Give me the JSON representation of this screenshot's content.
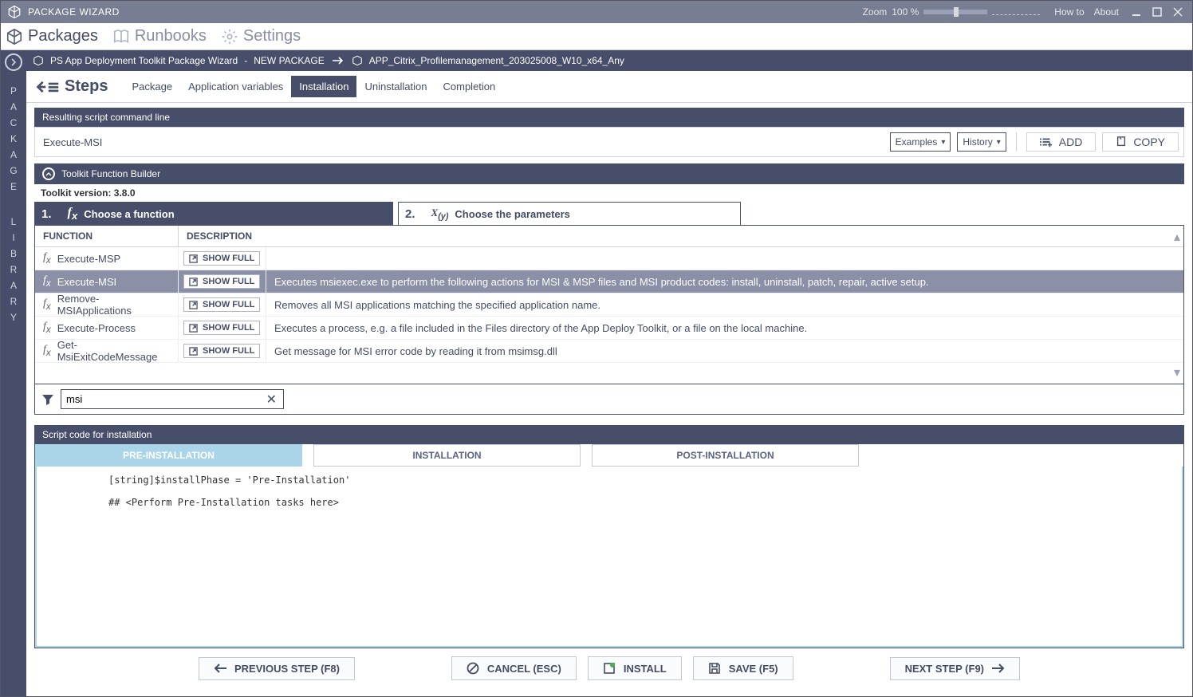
{
  "titlebar": {
    "app_title": "PACKAGE WIZARD",
    "zoom_label": "Zoom",
    "zoom_value": "100 %",
    "howto": "How to",
    "about": "About"
  },
  "topnav": {
    "packages": "Packages",
    "runbooks": "Runbooks",
    "settings": "Settings"
  },
  "sidebar": {
    "label1": "PACKAGE",
    "label2": "LIBRARY"
  },
  "breadcrumb": {
    "wizard": "PS App Deployment Toolkit Package Wizard",
    "sep": "-",
    "newpkg": "NEW PACKAGE",
    "target": "APP_Citrix_Profilemanagement_203025008_W10_x64_Any"
  },
  "stepsbar": {
    "label": "Steps",
    "items": [
      "Package",
      "Application variables",
      "Installation",
      "Uninstallation",
      "Completion"
    ],
    "active_index": 2
  },
  "cmdline": {
    "heading": "Resulting script command line",
    "value": "Execute-MSI",
    "examples": "Examples",
    "history": "History",
    "add": "ADD",
    "copy": "COPY"
  },
  "tfb": {
    "heading": "Toolkit Function Builder",
    "version_label": "Toolkit version:",
    "version": "3.8.0",
    "step1": "Choose a function",
    "step2": "Choose the parameters",
    "col_function": "FUNCTION",
    "col_description": "DESCRIPTION",
    "showfull": "SHOW FULL",
    "filter_value": "msi",
    "rows": [
      {
        "name": "Execute-MSP",
        "desc": ""
      },
      {
        "name": "Execute-MSI",
        "desc": "Executes msiexec.exe to perform the following actions for MSI & MSP files and MSI product codes: install, uninstall, patch, repair, active setup.",
        "selected": true
      },
      {
        "name": "Remove-MSIApplications",
        "desc": "Removes all MSI applications matching the specified application name."
      },
      {
        "name": "Execute-Process",
        "desc": "Executes a process, e.g. a file included in the Files directory of the App Deploy Toolkit, or a file on the local machine."
      },
      {
        "name": "Get-MsiExitCodeMessage",
        "desc": "Get message for MSI error code by reading it from msimsg.dll"
      }
    ]
  },
  "script": {
    "heading": "Script code for installation",
    "tabs": [
      "PRE-INSTALLATION",
      "INSTALLATION",
      "POST-INSTALLATION"
    ],
    "active_tab": 0,
    "code": "[string]$installPhase = 'Pre-Installation'\n\n## <Perform Pre-Installation tasks here>"
  },
  "footer": {
    "prev": "PREVIOUS STEP (F8)",
    "cancel": "CANCEL (ESC)",
    "install": "INSTALL",
    "save": "SAVE (F5)",
    "next": "NEXT STEP (F9)"
  }
}
